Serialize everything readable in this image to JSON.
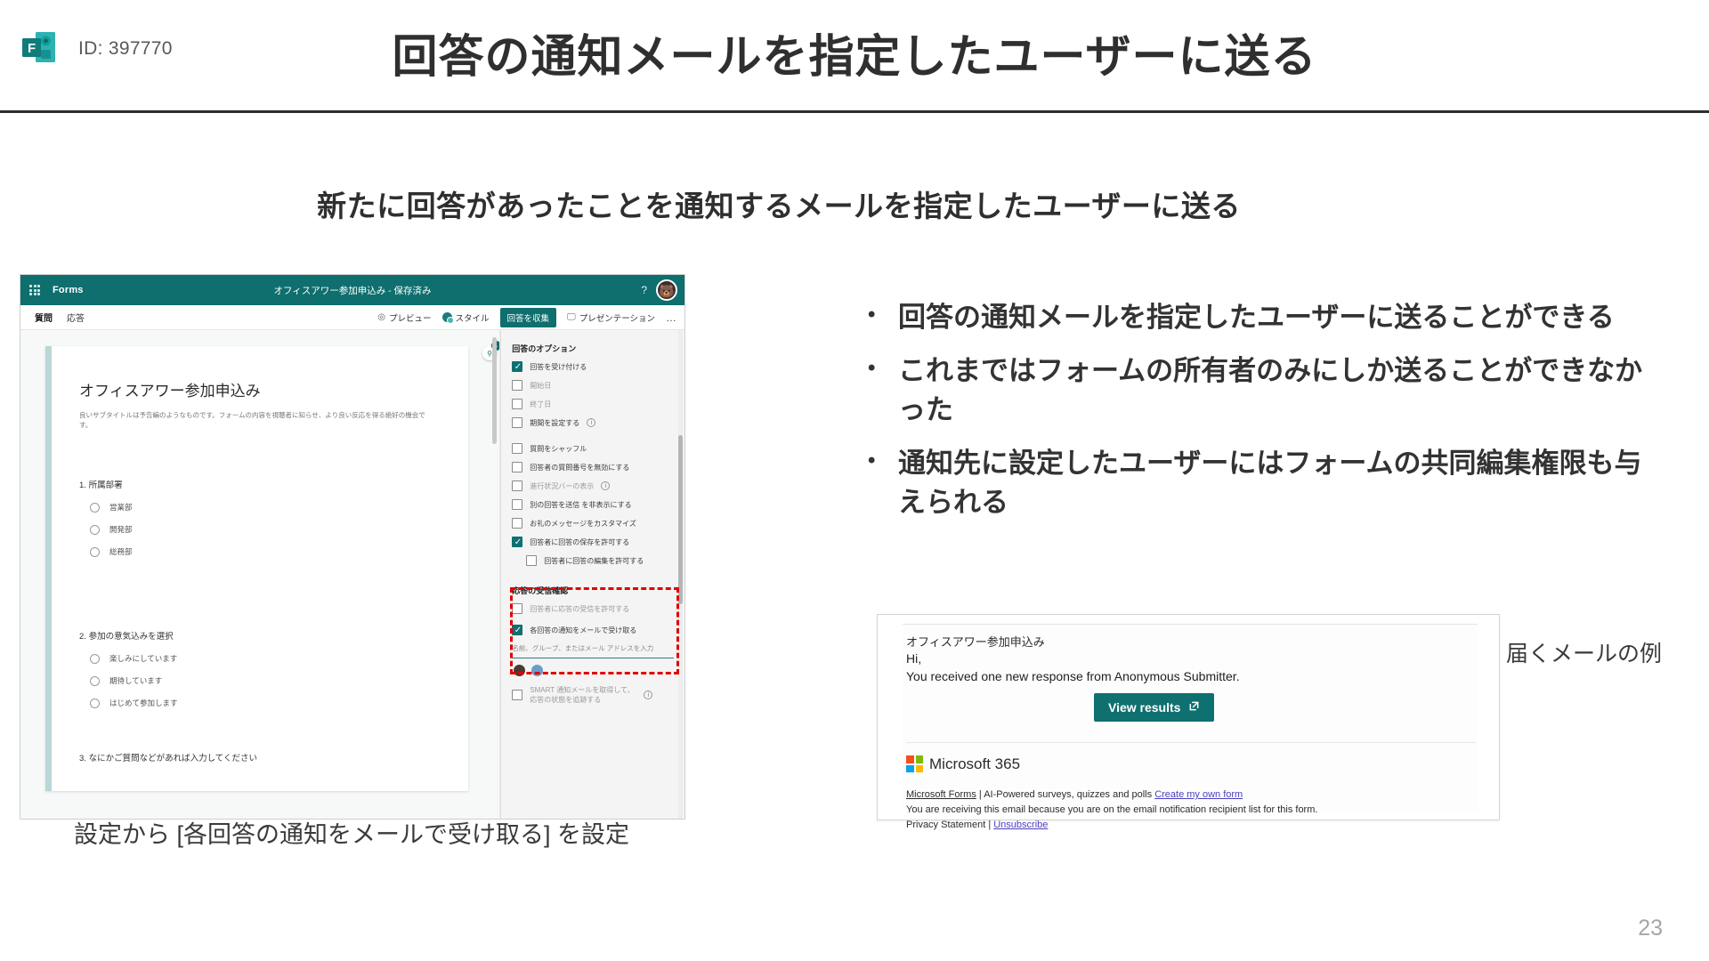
{
  "header": {
    "logo_icon": "microsoft-forms-icon",
    "id_label": "ID: 397770",
    "title": "回答の通知メールを指定したユーザーに送る"
  },
  "subtitle": "新たに回答があったことを通知するメールを指定したユーザーに送る",
  "bullets": [
    {
      "marker": "•",
      "text": "回答の通知メールを指定したユーザーに送ることができる"
    },
    {
      "marker": "•",
      "text": "これまではフォームの所有者のみにしか送ることができなかった"
    },
    {
      "marker": "•",
      "text": "通知先に設定したユーザーにはフォームの共同編集権限も与えられる"
    }
  ],
  "forms_app": {
    "brand": "Forms",
    "waffle_icon": "app-launcher-icon",
    "doc_name": "オフィスアワー参加申込み - 保存済み",
    "doc_chevron": "⌄",
    "help_icon": "?",
    "avatar_icon": "user-avatar",
    "avatar_glyph": "🐻",
    "tabs": [
      {
        "label": "質問",
        "active": true
      },
      {
        "label": "応答",
        "active": false
      }
    ],
    "tools": [
      {
        "label": "プレビュー",
        "icon": "eye-icon",
        "glyph": "◎",
        "primary": false
      },
      {
        "label": "スタイル",
        "icon": "style-palette-icon",
        "glyph": "",
        "primary": false
      },
      {
        "label": "回答を収集",
        "icon": "collect-icon",
        "glyph": "",
        "primary": true
      },
      {
        "label": "プレゼンテーション",
        "icon": "present-icon",
        "glyph": "🖵",
        "primary": false
      },
      {
        "label": "…",
        "icon": "more-options-icon",
        "glyph": "…",
        "primary": false
      }
    ],
    "form": {
      "title": "オフィスアワー参加申込み",
      "subtitle": "良いサブタイトルは予告編のようなものです。フォームの内容を視聴者に知らせ、より良い反応を得る絶好の機会です。",
      "pin_icon": "pin-icon",
      "pin_glyph": "⚲",
      "badge_count": "1",
      "questions": [
        {
          "number": "1.",
          "text": "所属部署",
          "options": [
            "営業部",
            "開発部",
            "総務部"
          ]
        },
        {
          "number": "2.",
          "text": "参加の意気込みを選択",
          "options": [
            "楽しみにしています",
            "期待しています",
            "はじめて参加します"
          ]
        },
        {
          "number": "3.",
          "text": "なにかご質問などがあれば入力してください",
          "options": []
        }
      ]
    },
    "settings_panel": {
      "section1_title": "回答のオプション",
      "options": [
        {
          "label": "回答を受け付ける",
          "checked": true,
          "dim": false,
          "info": false,
          "indent": false
        },
        {
          "label": "開始日",
          "checked": false,
          "dim": true,
          "info": false,
          "indent": false
        },
        {
          "label": "終了日",
          "checked": false,
          "dim": true,
          "info": false,
          "indent": false
        },
        {
          "label": "期間を設定する",
          "checked": false,
          "dim": false,
          "info": true,
          "indent": false
        },
        {
          "label": "質問をシャッフル",
          "checked": false,
          "dim": false,
          "info": false,
          "indent": false,
          "gap_before": true
        },
        {
          "label": "回答者の質問番号を無効にする",
          "checked": false,
          "dim": false,
          "info": false,
          "indent": false
        },
        {
          "label": "進行状況バーの表示",
          "checked": false,
          "dim": true,
          "info": true,
          "indent": false
        },
        {
          "label": "別の回答を送信 を非表示にする",
          "checked": false,
          "dim": false,
          "info": false,
          "indent": false
        },
        {
          "label": "お礼のメッセージをカスタマイズ",
          "checked": false,
          "dim": false,
          "info": false,
          "indent": false
        },
        {
          "label": "回答者に回答の保存を許可する",
          "checked": true,
          "dim": false,
          "info": false,
          "indent": false
        },
        {
          "label": "回答者に回答の編集を許可する",
          "checked": false,
          "dim": false,
          "info": false,
          "indent": true
        }
      ],
      "section2_title": "応答の受信確認",
      "options2": [
        {
          "label": "回答者に応答の受信を許可する",
          "checked": false,
          "dim": true,
          "info": false
        },
        {
          "label": "各回答の通知をメールで受け取る",
          "checked": true,
          "dim": false,
          "info": false
        }
      ],
      "recipient_placeholder": "名前、グループ、またはメール アドレスを入力",
      "chip_more": "…",
      "smart_option": {
        "label": "SMART 通知メールを取得して、応答の状態を追跡する",
        "checked": false,
        "dim": true,
        "info": true
      }
    }
  },
  "caption_left": "設定から [各回答の通知をメールで受け取る] を設定",
  "caption_right": "届くメールの例",
  "email_example": {
    "subject": "オフィスアワー参加申込み",
    "greeting": "Hi,",
    "body": "You received one new response from Anonymous Submitter.",
    "button_label": "View results",
    "button_icon": "external-link-icon",
    "button_glyph": "↗",
    "ms_logo_icon": "microsoft-logo-icon",
    "ms_name": "Microsoft 365",
    "footer_link1": "Microsoft Forms",
    "footer_text1": " | AI-Powered surveys, quizzes and polls ",
    "footer_link2": "Create my own form",
    "footer_text2": "You are receiving this email because you are on the email notification recipient list for this form.",
    "footer_text3": "Privacy Statement | ",
    "footer_link3": "Unsubscribe"
  },
  "page_number": "23",
  "colors": {
    "forms_teal": "#0f6e6e",
    "highlight_red": "#e00000",
    "title_gray": "#2f2f2f"
  }
}
